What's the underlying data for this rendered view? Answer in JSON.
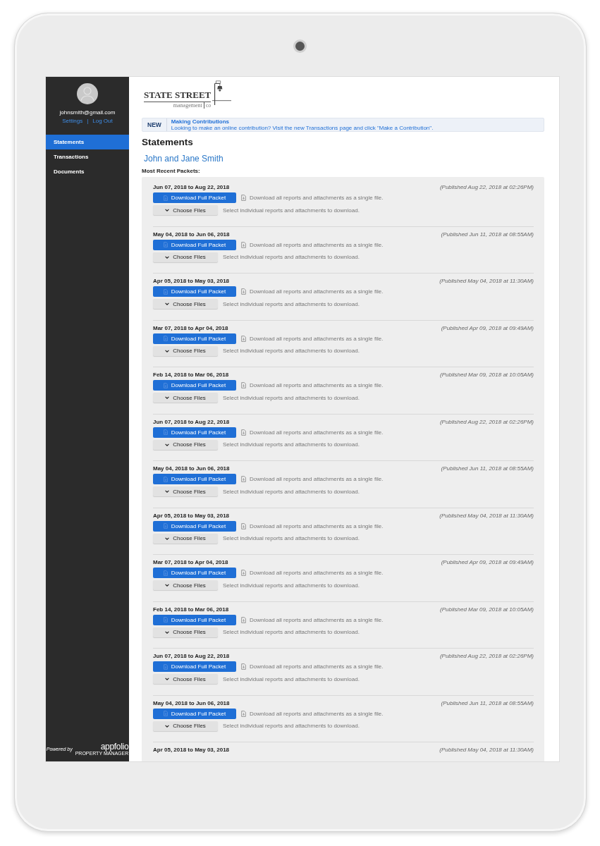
{
  "sidebar": {
    "email": "johnsmith@gmail.com",
    "links": [
      "Settings",
      "Log Out"
    ],
    "separator": "|",
    "items": [
      {
        "label": "Statements",
        "selected": true
      },
      {
        "label": "Transactions",
        "selected": false
      },
      {
        "label": "Documents",
        "selected": false
      }
    ],
    "footer": {
      "powered_by": "Powered by",
      "brand": "appfolio",
      "tagline": "PROPERTY MANAGER"
    }
  },
  "logo": {
    "name": "STATE STREET",
    "sub": "management",
    "suffix": "co"
  },
  "banner": {
    "badge": "NEW",
    "title": "Making Contributions",
    "text": "Looking to make an online contribution? Visit the new Transactions page and click \"Make a Contribution\"."
  },
  "heading": "Statements",
  "owner": "John and Jane Smith",
  "section_label": "Most Recent Packets:",
  "packets": [
    {
      "period": "Jun 07, 2018 to Aug 22, 2018",
      "published": "(Published Aug 22, 2018 at 02:26PM)",
      "download_button": "Download Full Packet",
      "download_hint": "Download all reports and attachments as a single file.",
      "choose_button": "Choose Files",
      "choose_hint": "Select individual reports and attachments to download."
    },
    {
      "period": "May 04, 2018 to Jun 06, 2018",
      "published": "(Published Jun 11, 2018 at 08:55AM)",
      "download_button": "Download Full Packet",
      "download_hint": "Download all reports and attachments as a single file.",
      "choose_button": "Choose Files",
      "choose_hint": "Select individual reports and attachments to download."
    },
    {
      "period": "Apr 05, 2018 to May 03, 2018",
      "published": "(Published May 04, 2018 at 11:30AM)",
      "download_button": "Download Full Packet",
      "download_hint": "Download all reports and attachments as a single file.",
      "choose_button": "Choose Files",
      "choose_hint": "Select individual reports and attachments to download."
    },
    {
      "period": "Mar 07, 2018 to Apr 04, 2018",
      "published": "(Published Apr 09, 2018 at 09:49AM)",
      "download_button": "Download Full Packet",
      "download_hint": "Download all reports and attachments as a single file.",
      "choose_button": "Choose Files",
      "choose_hint": "Select individual reports and attachments to download."
    },
    {
      "period": "Feb 14, 2018 to Mar 06, 2018",
      "published": "(Published Mar 09, 2018 at 10:05AM)",
      "download_button": "Download Full Packet",
      "download_hint": "Download all reports and attachments as a single file.",
      "choose_button": "Choose Files",
      "choose_hint": "Select individual reports and attachments to download."
    },
    {
      "period": "Jun 07, 2018 to Aug 22, 2018",
      "published": "(Published Aug 22, 2018 at 02:26PM)",
      "download_button": "Download Full Packet",
      "download_hint": "Download all reports and attachments as a single file.",
      "choose_button": "Choose Files",
      "choose_hint": "Select individual reports and attachments to download."
    },
    {
      "period": "May 04, 2018 to Jun 06, 2018",
      "published": "(Published Jun 11, 2018 at 08:55AM)",
      "download_button": "Download Full Packet",
      "download_hint": "Download all reports and attachments as a single file.",
      "choose_button": "Choose Files",
      "choose_hint": "Select individual reports and attachments to download."
    },
    {
      "period": "Apr 05, 2018 to May 03, 2018",
      "published": "(Published May 04, 2018 at 11:30AM)",
      "download_button": "Download Full Packet",
      "download_hint": "Download all reports and attachments as a single file.",
      "choose_button": "Choose Files",
      "choose_hint": "Select individual reports and attachments to download."
    },
    {
      "period": "Mar 07, 2018 to Apr 04, 2018",
      "published": "(Published Apr 09, 2018 at 09:49AM)",
      "download_button": "Download Full Packet",
      "download_hint": "Download all reports and attachments as a single file.",
      "choose_button": "Choose Files",
      "choose_hint": "Select individual reports and attachments to download."
    },
    {
      "period": "Feb 14, 2018 to Mar 06, 2018",
      "published": "(Published Mar 09, 2018 at 10:05AM)",
      "download_button": "Download Full Packet",
      "download_hint": "Download all reports and attachments as a single file.",
      "choose_button": "Choose Files",
      "choose_hint": "Select individual reports and attachments to download."
    },
    {
      "period": "Jun 07, 2018 to Aug 22, 2018",
      "published": "(Published Aug 22, 2018 at 02:26PM)",
      "download_button": "Download Full Packet",
      "download_hint": "Download all reports and attachments as a single file.",
      "choose_button": "Choose Files",
      "choose_hint": "Select individual reports and attachments to download."
    },
    {
      "period": "May 04, 2018 to Jun 06, 2018",
      "published": "(Published Jun 11, 2018 at 08:55AM)",
      "download_button": "Download Full Packet",
      "download_hint": "Download all reports and attachments as a single file.",
      "choose_button": "Choose Files",
      "choose_hint": "Select individual reports and attachments to download."
    },
    {
      "period": "Apr 05, 2018 to May 03, 2018",
      "published": "(Published May 04, 2018 at 11:30AM)"
    }
  ]
}
